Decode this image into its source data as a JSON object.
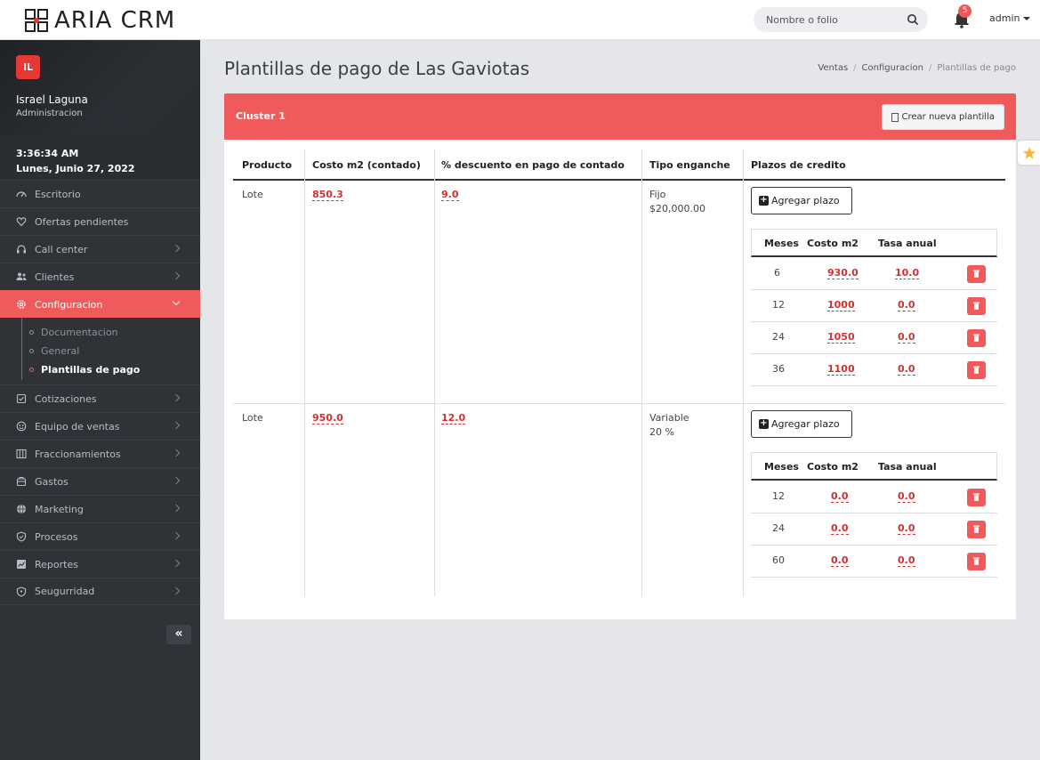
{
  "app": {
    "logo_text": "ARIA CRM"
  },
  "header": {
    "search_placeholder": "Nombre o folio",
    "notifications_count": "5",
    "user_label": "admin"
  },
  "sidebar": {
    "avatar_initials": "IL",
    "user_name": "Israel Laguna",
    "user_role": "Administracion",
    "clock_time": "3:36:34 AM",
    "clock_date": "Lunes, Junio 27, 2022",
    "items": [
      {
        "label": "Escritorio",
        "icon": "dashboard-icon"
      },
      {
        "label": "Ofertas pendientes",
        "icon": "heart-icon"
      },
      {
        "label": "Call center",
        "icon": "headset-icon"
      },
      {
        "label": "Clientes",
        "icon": "users-icon"
      },
      {
        "label": "Configuracion",
        "icon": "gear-icon"
      },
      {
        "label": "Cotizaciones",
        "icon": "checkbox-icon"
      },
      {
        "label": "Equipo de ventas",
        "icon": "team-icon"
      },
      {
        "label": "Fraccionamientos",
        "icon": "columns-icon"
      },
      {
        "label": "Gastos",
        "icon": "wallet-icon"
      },
      {
        "label": "Marketing",
        "icon": "globe-icon"
      },
      {
        "label": "Procesos",
        "icon": "shield-check-icon"
      },
      {
        "label": "Reportes",
        "icon": "chart-icon"
      },
      {
        "label": "Seugurridad",
        "icon": "shield-icon"
      }
    ],
    "subitems": [
      "Documentacion",
      "General",
      "Plantillas de pago"
    ],
    "collapse_label": "«"
  },
  "page": {
    "title": "Plantillas de pago de Las Gaviotas",
    "breadcrumb": [
      "Ventas",
      "Configuracion",
      "Plantillas de pago"
    ]
  },
  "card": {
    "cluster_title": "Cluster 1",
    "create_button": "Crear nueva plantilla",
    "columns": [
      "Producto",
      "Costo m2 (contado)",
      "% descuento en pago de contado",
      "Tipo enganche",
      "Plazos de credito"
    ],
    "add_term_label": "Agregar plazo",
    "sub_columns": [
      "Meses",
      "Costo m2",
      "Tasa anual"
    ],
    "templates": [
      {
        "product": "Lote",
        "cost": "850.3",
        "discount": "9.0",
        "down_type": "Fijo",
        "down_value": "$20,000.00",
        "terms": [
          {
            "months": "6",
            "cost": "930.0",
            "rate": "10.0"
          },
          {
            "months": "12",
            "cost": "1000",
            "rate": "0.0"
          },
          {
            "months": "24",
            "cost": "1050",
            "rate": "0.0"
          },
          {
            "months": "36",
            "cost": "1100",
            "rate": "0.0"
          }
        ]
      },
      {
        "product": "Lote",
        "cost": "950.0",
        "discount": "12.0",
        "down_type": "Variable",
        "down_value": "20 %",
        "terms": [
          {
            "months": "12",
            "cost": "0.0",
            "rate": "0.0"
          },
          {
            "months": "24",
            "cost": "0.0",
            "rate": "0.0"
          },
          {
            "months": "60",
            "cost": "0.0",
            "rate": "0.0"
          }
        ]
      }
    ]
  },
  "colors": {
    "accent": "#f15a5a",
    "sidebar": "#2f3338",
    "editable": "#d32f2f"
  }
}
